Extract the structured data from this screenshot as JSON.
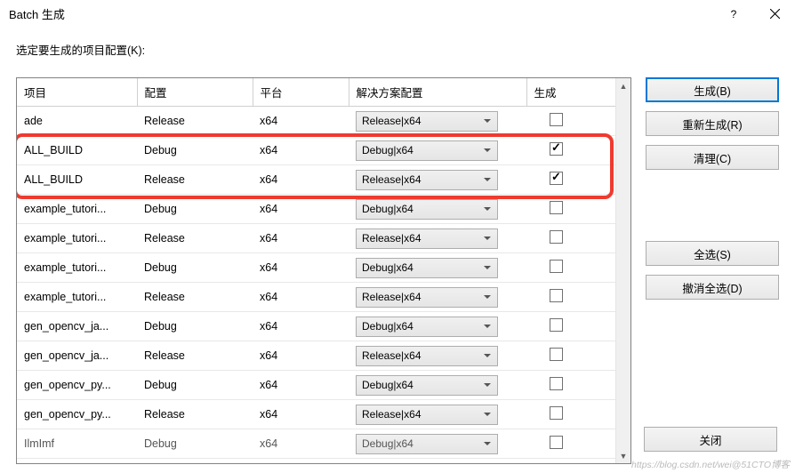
{
  "title": "Batch 生成",
  "label": "选定要生成的项目配置(K):",
  "headers": {
    "project": "项目",
    "config": "配置",
    "platform": "平台",
    "solution": "解决方案配置",
    "generate": "生成"
  },
  "rows": [
    {
      "project": "ade",
      "config": "Release",
      "platform": "x64",
      "sol": "Release|x64",
      "checked": false
    },
    {
      "project": "ALL_BUILD",
      "config": "Debug",
      "platform": "x64",
      "sol": "Debug|x64",
      "checked": true
    },
    {
      "project": "ALL_BUILD",
      "config": "Release",
      "platform": "x64",
      "sol": "Release|x64",
      "checked": true
    },
    {
      "project": "example_tutori...",
      "config": "Debug",
      "platform": "x64",
      "sol": "Debug|x64",
      "checked": false
    },
    {
      "project": "example_tutori...",
      "config": "Release",
      "platform": "x64",
      "sol": "Release|x64",
      "checked": false
    },
    {
      "project": "example_tutori...",
      "config": "Debug",
      "platform": "x64",
      "sol": "Debug|x64",
      "checked": false
    },
    {
      "project": "example_tutori...",
      "config": "Release",
      "platform": "x64",
      "sol": "Release|x64",
      "checked": false
    },
    {
      "project": "gen_opencv_ja...",
      "config": "Debug",
      "platform": "x64",
      "sol": "Debug|x64",
      "checked": false
    },
    {
      "project": "gen_opencv_ja...",
      "config": "Release",
      "platform": "x64",
      "sol": "Release|x64",
      "checked": false
    },
    {
      "project": "gen_opencv_py...",
      "config": "Debug",
      "platform": "x64",
      "sol": "Debug|x64",
      "checked": false
    },
    {
      "project": "gen_opencv_py...",
      "config": "Release",
      "platform": "x64",
      "sol": "Release|x64",
      "checked": false
    },
    {
      "project": "IlmImf",
      "config": "Debug",
      "platform": "x64",
      "sol": "Debug|x64",
      "checked": false
    }
  ],
  "buttons": {
    "build": "生成(B)",
    "rebuild": "重新生成(R)",
    "clean": "清理(C)",
    "selectAll": "全选(S)",
    "deselectAll": "撤消全选(D)",
    "close": "关闭"
  },
  "watermark": "https://blog.csdn.net/wei@51CTO博客"
}
